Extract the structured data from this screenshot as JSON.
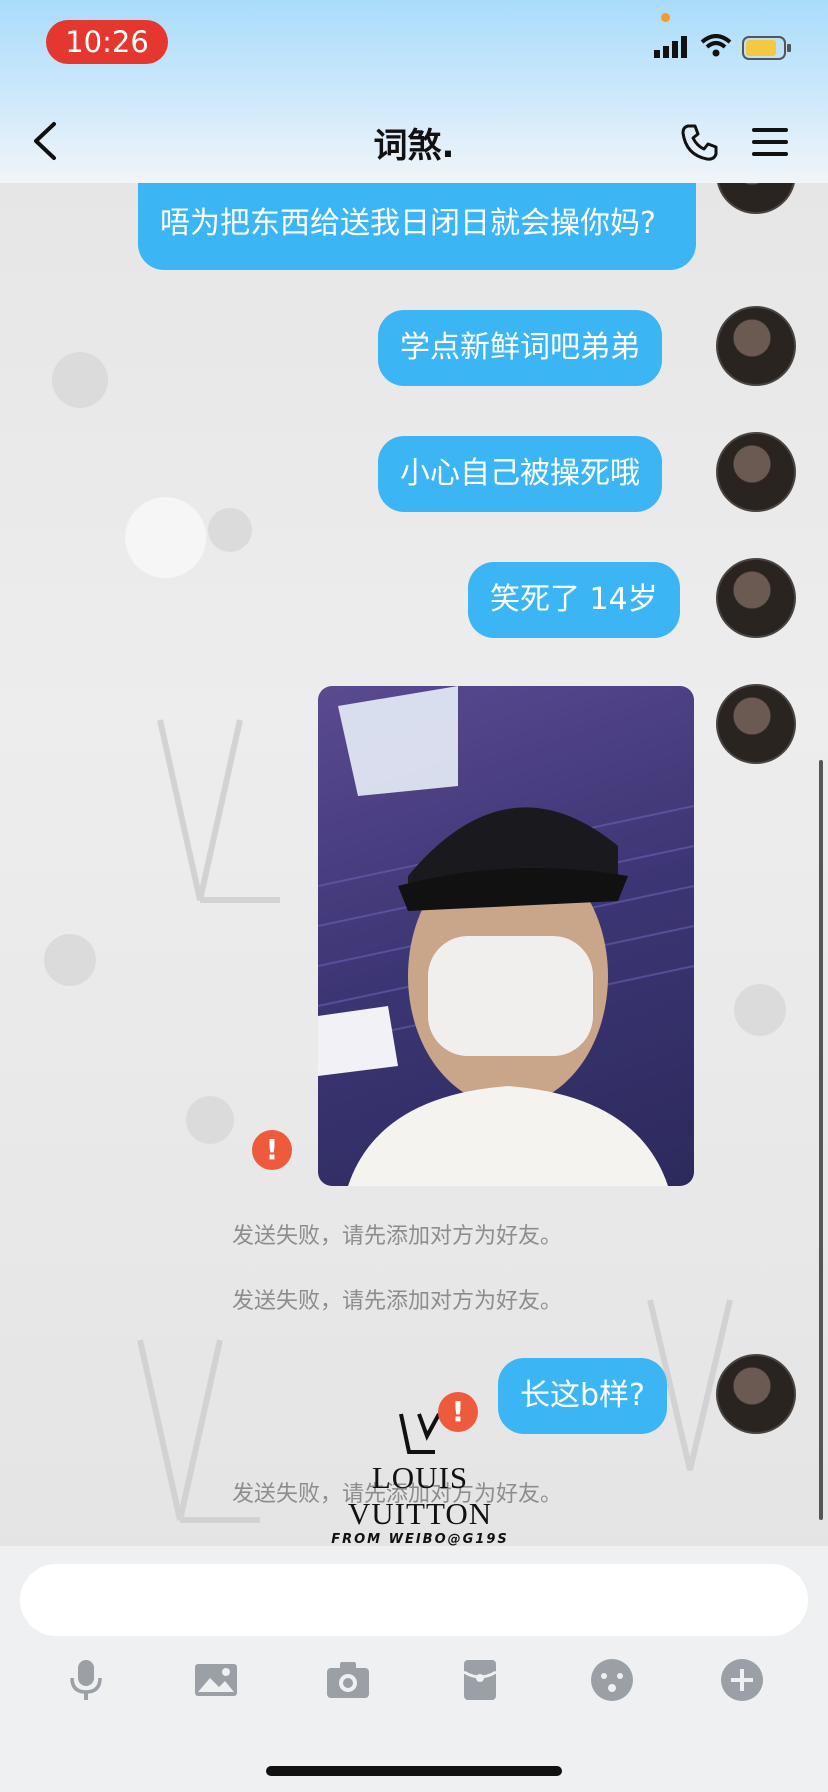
{
  "status_bar": {
    "time": "10:26"
  },
  "header": {
    "title": "词煞."
  },
  "messages": [
    {
      "type": "text",
      "text": "唔为把东西给送我日闭日就会操你妈?"
    },
    {
      "type": "text",
      "text": "学点新鲜词吧弟弟"
    },
    {
      "type": "text",
      "text": "小心自己被操死哦"
    },
    {
      "type": "text",
      "text": "笑死了 14岁"
    },
    {
      "type": "image",
      "status": "failed"
    },
    {
      "type": "text",
      "text": "长这b样?",
      "status": "failed"
    }
  ],
  "system_notes": [
    "发送失败，请先添加对方为好友。",
    "发送失败，请先添加对方为好友。",
    "发送失败，请先添加对方为好友。"
  ],
  "watermark": {
    "brand": "LOUIS VUITTON",
    "sub": "FROM WEIBO@G19S"
  },
  "input": {
    "value": "",
    "placeholder": ""
  },
  "toolbar": [
    "mic-icon",
    "image-icon",
    "camera-icon",
    "red-packet-icon",
    "emoji-icon",
    "plus-icon"
  ],
  "colors": {
    "bubble": "#3cb5f5",
    "fail": "#ee5a3c",
    "time_pill": "#e4372f"
  }
}
